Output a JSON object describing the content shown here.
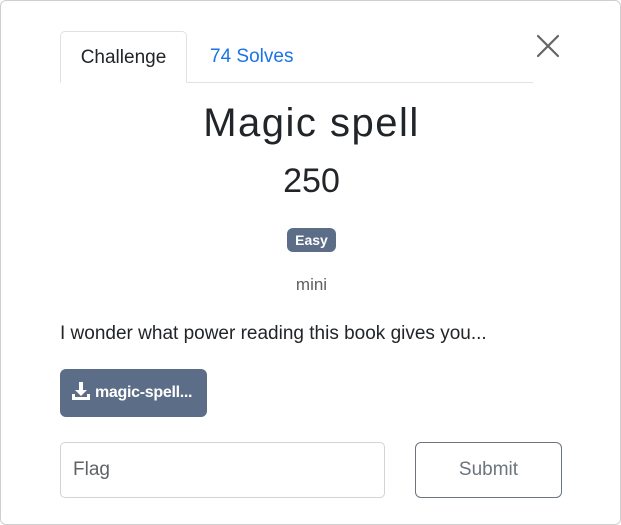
{
  "tabs": [
    {
      "label": "Challenge",
      "active": true
    },
    {
      "label": "74 Solves",
      "active": false
    }
  ],
  "challenge": {
    "title": "Magic spell",
    "value": "250",
    "difficulty": "Easy",
    "author": "mini",
    "description": "I wonder what power reading this book gives you...",
    "file_label": "magic-spell..."
  },
  "flag": {
    "placeholder": "Flag",
    "value": ""
  },
  "submit_label": "Submit",
  "colors": {
    "badge": "#5c6d87",
    "link": "#1a73e8",
    "border": "#dee2e6"
  },
  "icons": {
    "close": "close-icon",
    "download": "download-icon"
  }
}
